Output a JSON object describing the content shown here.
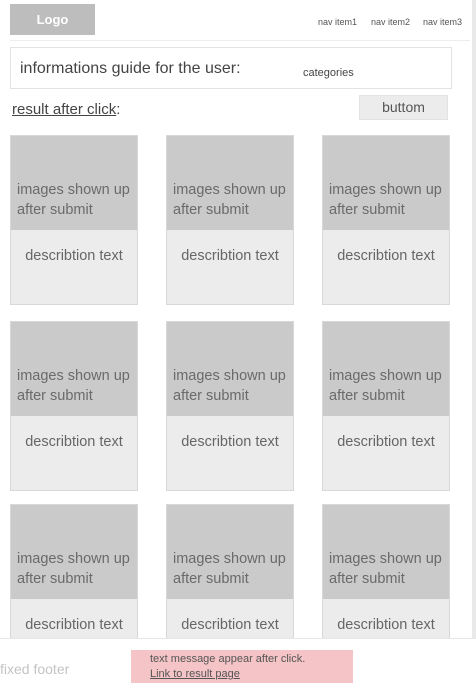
{
  "header": {
    "logo": "Logo",
    "nav": [
      {
        "label": "nav item1"
      },
      {
        "label": "nav item2"
      },
      {
        "label": "nav item3"
      }
    ]
  },
  "info": {
    "guide": "informations guide for the user:",
    "categories": "categories"
  },
  "results": {
    "label": "result after click",
    "colon": ":",
    "button": "buttom"
  },
  "cards": [
    {
      "image_text": "images shown up after submit",
      "description": "describtion text"
    },
    {
      "image_text": "images shown up after submit",
      "description": "describtion text"
    },
    {
      "image_text": "images shown up after submit",
      "description": "describtion text"
    },
    {
      "image_text": "images shown up after submit",
      "description": "describtion text"
    },
    {
      "image_text": "images shown up after submit",
      "description": "describtion text"
    },
    {
      "image_text": "images shown up after submit",
      "description": "describtion text"
    },
    {
      "image_text": "images shown up after submit",
      "description": "describtion text"
    },
    {
      "image_text": "images shown up after submit",
      "description": "describtion text"
    },
    {
      "image_text": "images shown up after submit",
      "description": "describtion text"
    }
  ],
  "footer": {
    "label": "fixed footer",
    "message": "text message appear after click. ",
    "link": "Link to result page "
  },
  "colors": {
    "placeholder": "#cacaca",
    "card_body": "#ececec",
    "toast": "#f4c4c6"
  }
}
